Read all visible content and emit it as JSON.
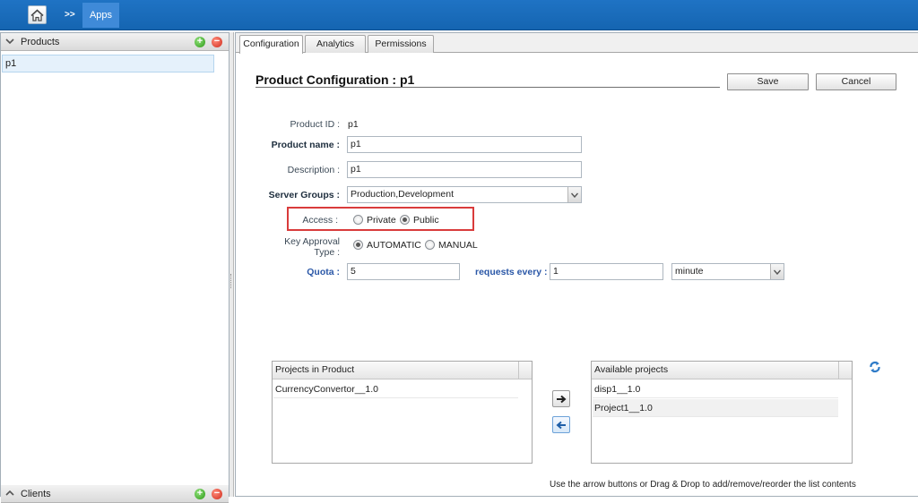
{
  "breadcrumb": {
    "separator": ">>",
    "current": "Apps"
  },
  "left_panel": {
    "products_header": "Products",
    "products": [
      "p1"
    ],
    "clients_header": "Clients"
  },
  "tabs": [
    {
      "label": "Configuration",
      "active": true
    },
    {
      "label": "Analytics",
      "active": false
    },
    {
      "label": "Permissions",
      "active": false
    }
  ],
  "config": {
    "title": "Product Configuration : p1",
    "save_label": "Save",
    "cancel_label": "Cancel",
    "product_id_label": "Product ID :",
    "product_id_value": "p1",
    "product_name_label": "Product name :",
    "product_name_value": "p1",
    "description_label": "Description :",
    "description_value": "p1",
    "server_groups_label": "Server Groups :",
    "server_groups_value": "Production,Development",
    "access_label": "Access :",
    "access_options": [
      "Private",
      "Public"
    ],
    "access_selected": "Public",
    "key_approval_label_line1": "Key Approval",
    "key_approval_label_line2": "Type :",
    "key_approval_options": [
      "AUTOMATIC",
      "MANUAL"
    ],
    "key_approval_selected": "AUTOMATIC",
    "quota_label": "Quota :",
    "quota_value": "5",
    "requests_every_label": "requests every :",
    "requests_every_value": "1",
    "time_unit_value": "minute"
  },
  "projects": {
    "in_product_header": "Projects in Product",
    "in_product": [
      "CurrencyConvertor__1.0"
    ],
    "available_header": "Available projects",
    "available": [
      "disp1__1.0",
      "Project1__1.0"
    ],
    "hint": "Use the arrow buttons or Drag & Drop to add/remove/reorder the list contents"
  },
  "colors": {
    "topbar": "#1565b1",
    "breadcrumb_active": "#3f8ad8",
    "highlight": "#d93b3b",
    "selected_row": "#e5f1fb"
  }
}
